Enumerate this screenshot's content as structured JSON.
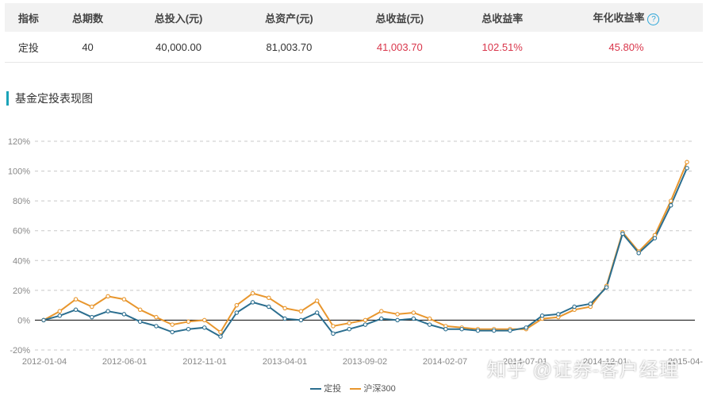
{
  "summary": {
    "headers": [
      "指标",
      "总期数",
      "总投入(元)",
      "总资产(元)",
      "总收益(元)",
      "总收益率",
      "年化收益率"
    ],
    "help_icon": "?",
    "row": [
      "定投",
      "40",
      "40,000.00",
      "81,003.70",
      "41,003.70",
      "102.51%",
      "45.80%"
    ]
  },
  "section_title": "基金定投表现图",
  "colors": {
    "series1": "#2b6e8f",
    "series2": "#e8962d",
    "profit_red": "#d9364b",
    "accent": "#1aa3b8"
  },
  "chart_data": {
    "type": "line",
    "x_tick_labels": [
      "2012-01-04",
      "2012-06-01",
      "2012-11-01",
      "2013-04-01",
      "2013-09-02",
      "2014-02-07",
      "2014-07-01",
      "2014-12-01",
      "2015-04-"
    ],
    "y_tick_labels": [
      "-20%",
      "0%",
      "20%",
      "40%",
      "60%",
      "80%",
      "100%",
      "120%"
    ],
    "ylim": [
      -20,
      120
    ],
    "grid": true,
    "legend_position": "bottom",
    "series": [
      {
        "name": "定投",
        "values": [
          0,
          3,
          7,
          2,
          6,
          4,
          -1,
          -4,
          -8,
          -6,
          -5,
          -11,
          5,
          12,
          9,
          1,
          0,
          5,
          -9,
          -6,
          -3,
          1,
          0,
          1,
          -3,
          -6,
          -6,
          -7,
          -7,
          -7,
          -5,
          3,
          4,
          9,
          11,
          22,
          58,
          45,
          55,
          77,
          102
        ]
      },
      {
        "name": "沪深300",
        "values": [
          0,
          6,
          14,
          9,
          16,
          14,
          7,
          2,
          -3,
          -1,
          0,
          -8,
          10,
          18,
          15,
          8,
          6,
          13,
          -4,
          -2,
          0,
          6,
          4,
          5,
          1,
          -4,
          -5,
          -6,
          -6,
          -6,
          -6,
          1,
          2,
          7,
          9,
          23,
          59,
          46,
          57,
          80,
          106
        ]
      }
    ]
  },
  "watermark": "知乎 @证券-客户经理"
}
